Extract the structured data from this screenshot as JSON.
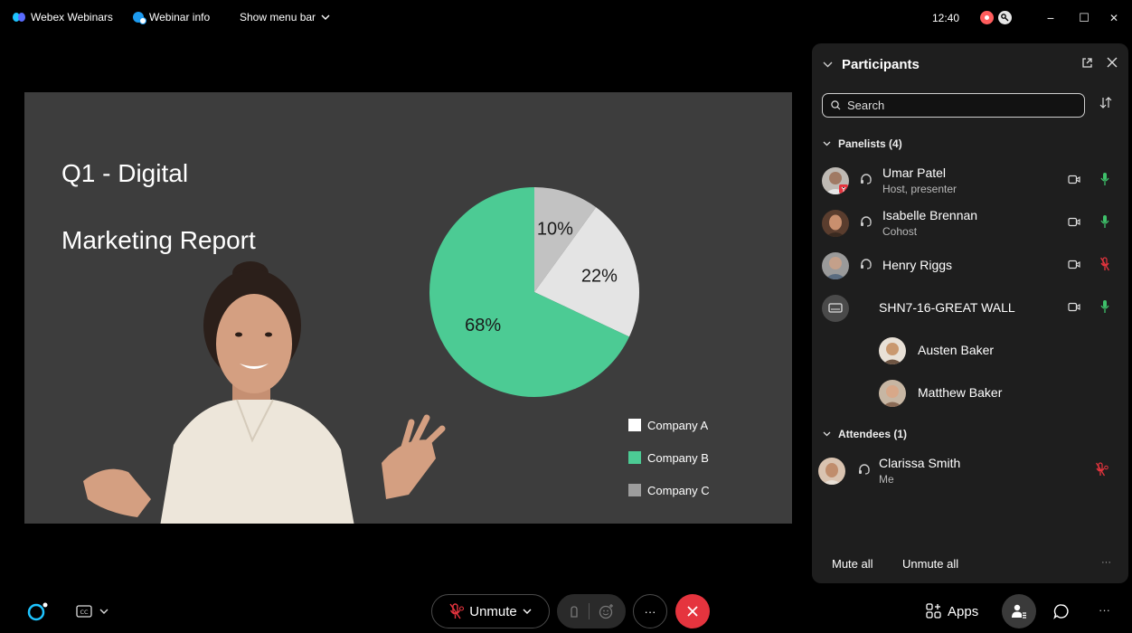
{
  "topbar": {
    "app_name": "Webex Webinars",
    "webinar_info": "Webinar info",
    "show_menu_bar": "Show menu bar",
    "time": "12:40",
    "minimize_glyph": "−",
    "maximize_glyph": "☐",
    "close_glyph": "✕"
  },
  "slide": {
    "title_line1": "Q1 - Digital",
    "title_line2": "Marketing Report"
  },
  "chart_data": {
    "type": "pie",
    "title": "",
    "slices": [
      {
        "name": "Company C",
        "value": 10,
        "label": "10%",
        "color": "#c2c2c2"
      },
      {
        "name": "Company A",
        "value": 22,
        "label": "22%",
        "color": "#e4e4e4"
      },
      {
        "name": "Company B",
        "value": 68,
        "label": "68%",
        "color": "#4ccb94"
      }
    ],
    "legend": [
      {
        "label": "Company A",
        "color": "#ffffff"
      },
      {
        "label": "Company B",
        "color": "#4ccb94"
      },
      {
        "label": "Company C",
        "color": "#9d9d9d"
      }
    ],
    "legend_placement": "bottom-right"
  },
  "participants": {
    "title": "Participants",
    "search_placeholder": "Search",
    "panelists_header": "Panelists (4)",
    "attendees_header": "Attendees (1)",
    "panelists": [
      {
        "name": "Umar Patel",
        "role": "Host, presenter",
        "mic": "on",
        "avatar_color": "#a48a7a"
      },
      {
        "name": "Isabelle Brennan",
        "role": "Cohost",
        "mic": "on",
        "avatar_color": "#6b4a3a"
      },
      {
        "name": "Henry Riggs",
        "role": "",
        "mic": "muted",
        "avatar_color": "#8a8a8a"
      },
      {
        "name": "SHN7-16-GREAT WALL",
        "role": "",
        "mic": "on",
        "avatar_color": "#4a4a4a"
      }
    ],
    "device_users": [
      {
        "name": "Austen Baker",
        "avatar_color": "#c9a078"
      },
      {
        "name": "Matthew Baker",
        "avatar_color": "#b5896a"
      }
    ],
    "attendees": [
      {
        "name": "Clarissa Smith",
        "role": "Me",
        "mic": "muted",
        "avatar_color": "#a97a5e"
      }
    ],
    "mute_all": "Mute all",
    "unmute_all": "Unmute all",
    "more": "···"
  },
  "bottombar": {
    "unmute_label": "Unmute",
    "more_label": "···",
    "apps_label": "Apps",
    "more_right": "···"
  },
  "colors": {
    "accent_green": "#3ec06a",
    "muted_red": "#e5343e",
    "slide_bg": "#3d3d3d",
    "panel_bg": "#1e1e1e"
  }
}
